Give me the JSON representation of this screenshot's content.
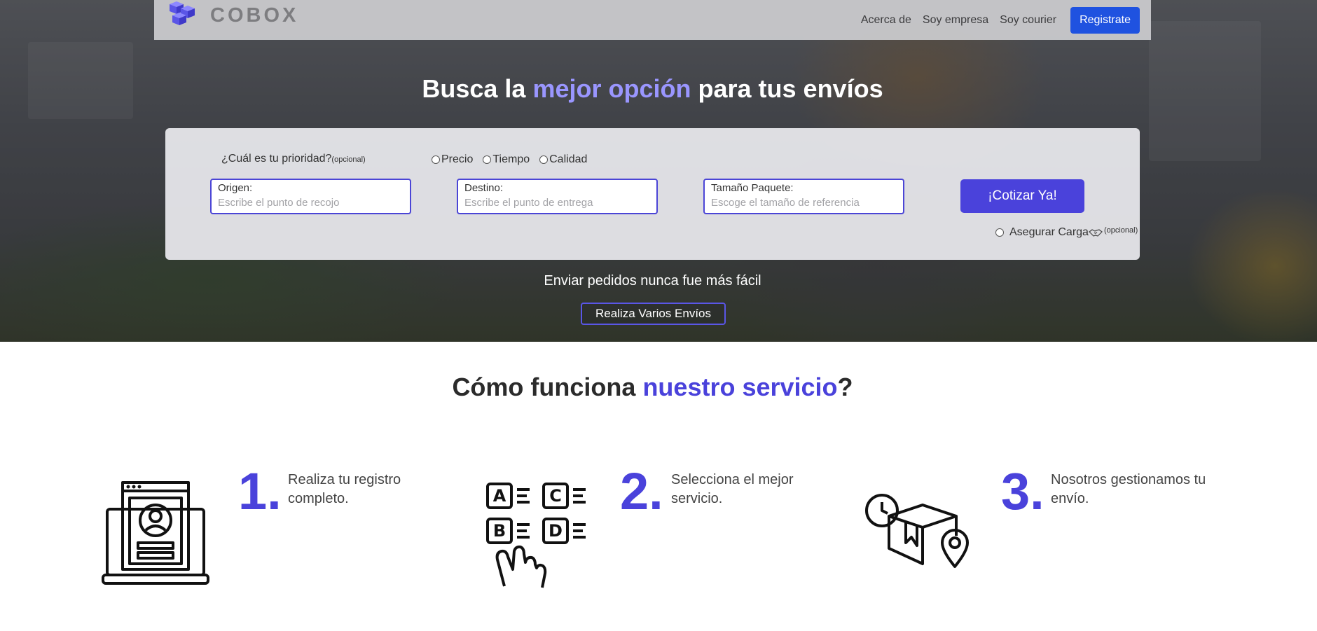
{
  "brand": {
    "name": "COBOX"
  },
  "nav": {
    "links": [
      "Acerca de",
      "Soy empresa",
      "Soy courier"
    ],
    "register_label": "Registrate"
  },
  "hero": {
    "title_pre": "Busca la ",
    "title_accent": "mejor opción",
    "title_post": " para tus envíos",
    "tagline": "Enviar pedidos nunca fue más fácil",
    "multi_button": "Realiza Varios Envíos"
  },
  "form": {
    "priority_question": "¿Cuál es tu prioridad?",
    "optional_small": "(opcional)",
    "priority_options": [
      "Precio",
      "Tiempo",
      "Calidad"
    ],
    "origin": {
      "label": "Origen:",
      "placeholder": "Escribe el punto de recojo"
    },
    "destination": {
      "label": "Destino:",
      "placeholder": "Escribe el punto de entrega"
    },
    "size": {
      "label": "Tamaño Paquete:",
      "placeholder": "Escoge el tamaño de referencia"
    },
    "quote_button": "¡Cotizar Ya!",
    "insure_label": "Asegurar Carga",
    "insure_optional": "(opcional)"
  },
  "how": {
    "title_pre": "Cómo funciona ",
    "title_accent": "nuestro servicio",
    "title_post": "?",
    "steps": [
      {
        "number": "1.",
        "text": "Realiza tu registro completo.",
        "icon": "profile-laptop-icon"
      },
      {
        "number": "2.",
        "text": "Selecciona el mejor servicio.",
        "icon": "abcd-choice-icon"
      },
      {
        "number": "3.",
        "text": "Nosotros gestionamos tu envío.",
        "icon": "package-delivery-icon"
      }
    ]
  },
  "colors": {
    "accent": "#4a42db",
    "hero_accent": "#9a96ff",
    "register_button": "#1f52e0"
  }
}
